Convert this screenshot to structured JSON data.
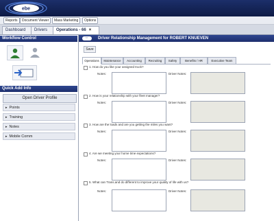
{
  "app": {
    "logo_text": "ebe"
  },
  "menu": [
    "Reports",
    "Document Viewer",
    "Mass Marketing",
    "Options"
  ],
  "tabs": [
    {
      "label": "Dashboard"
    },
    {
      "label": "Drivers"
    },
    {
      "label": "Operations - 66",
      "close": "×"
    }
  ],
  "sidebar": {
    "workflow_title": "Workflow Control",
    "quick_add_title": "Quick Add Info",
    "profile_button": "Open Driver Profile",
    "items": [
      "Points",
      "Training",
      "Notes",
      "Mobile Comm"
    ]
  },
  "main": {
    "title": "Driver Relationship Management for ROBERT KNUEVEN",
    "save_label": "Save",
    "subtabs": [
      "Operations",
      "Maintenance",
      "Accounting",
      "Recruiting",
      "Safety",
      "Benefits / HR",
      "Executive Team"
    ],
    "notes_label": "Notes:",
    "driver_notes_label": "Driver Notes:",
    "questions": [
      "1.  How do you like your assigned truck?",
      "2.  How is your relationship with your fleet manager?",
      "3.  How are the loads and are you getting the miles you want?",
      "4.  Are we meeting your home time expectations?",
      "5.  What can Trans.and do different to improve your quality of life with us?"
    ]
  }
}
